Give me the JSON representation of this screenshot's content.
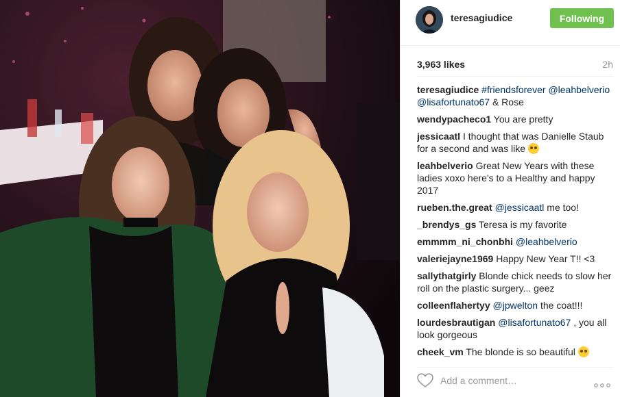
{
  "post": {
    "username": "teresagiudice",
    "follow_label": "Following",
    "likes": "3,963 likes",
    "time": "2h"
  },
  "comments": [
    {
      "user": "teresagiudice",
      "parts": [
        {
          "text": "#friendsforever",
          "link": true
        },
        {
          "text": " ",
          "link": false
        },
        {
          "text": "@leahbelverio",
          "link": true
        },
        {
          "text": " ",
          "link": false
        },
        {
          "text": "@lisafortunato67",
          "link": true
        },
        {
          "text": " & Rose",
          "link": false
        }
      ]
    },
    {
      "user": "wendypacheco1",
      "parts": [
        {
          "text": "You are pretty",
          "link": false
        }
      ]
    },
    {
      "user": "jessicaatl",
      "parts": [
        {
          "text": "I thought that was Danielle Staub for a second and was like",
          "link": false
        }
      ],
      "emoji": "flushed-face"
    },
    {
      "user": "leahbelverio",
      "parts": [
        {
          "text": "Great New Years with these ladies xoxo here's to a Healthy and happy 2017",
          "link": false
        }
      ]
    },
    {
      "user": "rueben.the.great",
      "parts": [
        {
          "text": "@jessicaatl",
          "link": true
        },
        {
          "text": " me too!",
          "link": false
        }
      ]
    },
    {
      "user": "_brendys_gs",
      "parts": [
        {
          "text": "Teresa is my favorite",
          "link": false
        }
      ]
    },
    {
      "user": "emmmm_ni_chonbhi",
      "parts": [
        {
          "text": "@leahbelverio",
          "link": true
        }
      ]
    },
    {
      "user": "valeriejayne1969",
      "parts": [
        {
          "text": "Happy New Year T!! <3",
          "link": false
        }
      ]
    },
    {
      "user": "sallythatgirly",
      "parts": [
        {
          "text": "Blonde chick needs to slow her roll on the plastic surgery... geez",
          "link": false
        }
      ]
    },
    {
      "user": "colleenflahertyy",
      "parts": [
        {
          "text": "@jpwelton",
          "link": true
        },
        {
          "text": " the coat!!!",
          "link": false
        }
      ]
    },
    {
      "user": "lourdesbrautigan",
      "parts": [
        {
          "text": "@lisafortunato67",
          "link": true
        },
        {
          "text": " , you all look gorgeous",
          "link": false
        }
      ]
    },
    {
      "user": "cheek_vm",
      "parts": [
        {
          "text": "The blonde is so beautiful",
          "link": false
        }
      ],
      "emoji": "heart-eyes-face"
    }
  ],
  "add_comment": {
    "placeholder": "Add a comment…"
  },
  "icons": {
    "like": "heart-outline-icon",
    "more": "more-options-icon"
  },
  "colors": {
    "follow_button": "#70c050",
    "link": "#003569",
    "muted": "#999999"
  }
}
